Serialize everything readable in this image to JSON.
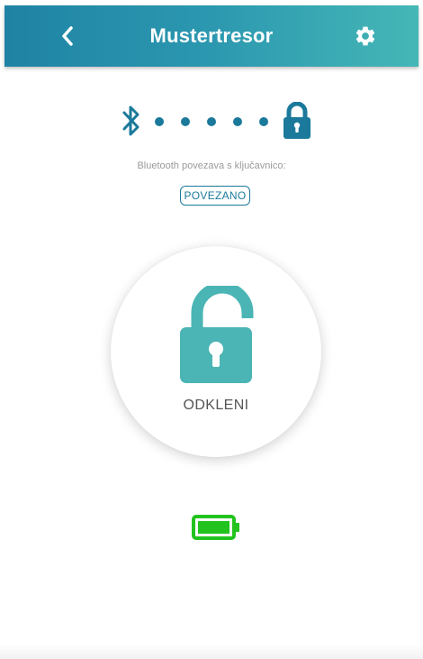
{
  "header": {
    "title": "Mustertresor",
    "back_icon": "chevron-left-icon",
    "settings_icon": "gear-icon"
  },
  "connection": {
    "bluetooth_icon": "bluetooth-icon",
    "lock_icon": "lock-icon",
    "label": "Bluetooth povezava s ključavnico:",
    "status": "POVEZANO"
  },
  "unlock": {
    "label": "ODKLENI",
    "icon": "unlock-icon"
  },
  "battery": {
    "icon": "battery-icon",
    "level": 1.0
  },
  "colors": {
    "header_start": "#1f83a4",
    "header_end": "#45b7b6",
    "accent": "#1b7a9b",
    "lock_teal": "#4ab5b4",
    "battery_green": "#22c31e"
  }
}
